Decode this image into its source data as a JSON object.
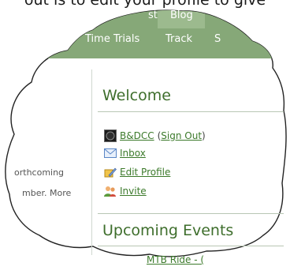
{
  "caption": "out is to edit your profile to give",
  "nav": {
    "top_item": "Blog",
    "top_partial": "st",
    "items": [
      "Time Trials",
      "Track",
      "S"
    ]
  },
  "left_snippet": {
    "line1": "orthcoming",
    "line2": "mber. More"
  },
  "welcome": {
    "title": "Welcome",
    "club": "B&DCC",
    "sign_out": "Sign Out",
    "paren_open": "(",
    "paren_close": ")",
    "inbox": "Inbox",
    "edit_profile": "Edit Profile",
    "invite": "Invite"
  },
  "events": {
    "title": "Upcoming Events",
    "first": "MTB Ride - ("
  },
  "colors": {
    "nav_green": "#86a878",
    "heading_green": "#3e6e2c",
    "link_green": "#3c7a2b"
  }
}
